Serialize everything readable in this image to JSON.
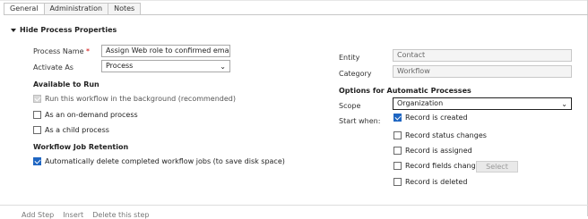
{
  "tabs": [
    {
      "label": "General"
    },
    {
      "label": "Administration"
    },
    {
      "label": "Notes"
    }
  ],
  "section_title": "Hide Process Properties",
  "left": {
    "process_name_label": "Process Name",
    "required_mark": "*",
    "process_name_value": "Assign Web role to confirmed email",
    "activate_as_label": "Activate As",
    "activate_as_value": "Process",
    "available_heading": "Available to Run",
    "available_options": [
      {
        "label": "Run this workflow in the background (recommended)"
      },
      {
        "label": "As an on-demand process"
      },
      {
        "label": "As a child process"
      }
    ],
    "retention_heading": "Workflow Job Retention",
    "retention_option": "Automatically delete completed workflow jobs (to save disk space)"
  },
  "right": {
    "entity_label": "Entity",
    "entity_value": "Contact",
    "category_label": "Category",
    "category_value": "Workflow",
    "options_heading": "Options for Automatic Processes",
    "scope_label": "Scope",
    "scope_value": "Organization",
    "start_when_label": "Start when:",
    "start_options": [
      {
        "label": "Record is created"
      },
      {
        "label": "Record status changes"
      },
      {
        "label": "Record is assigned"
      },
      {
        "label": "Record fields change"
      },
      {
        "label": "Record is deleted"
      }
    ],
    "select_button": "Select"
  },
  "footer": {
    "add_step": "Add Step",
    "insert": "Insert",
    "delete": "Delete this step"
  }
}
